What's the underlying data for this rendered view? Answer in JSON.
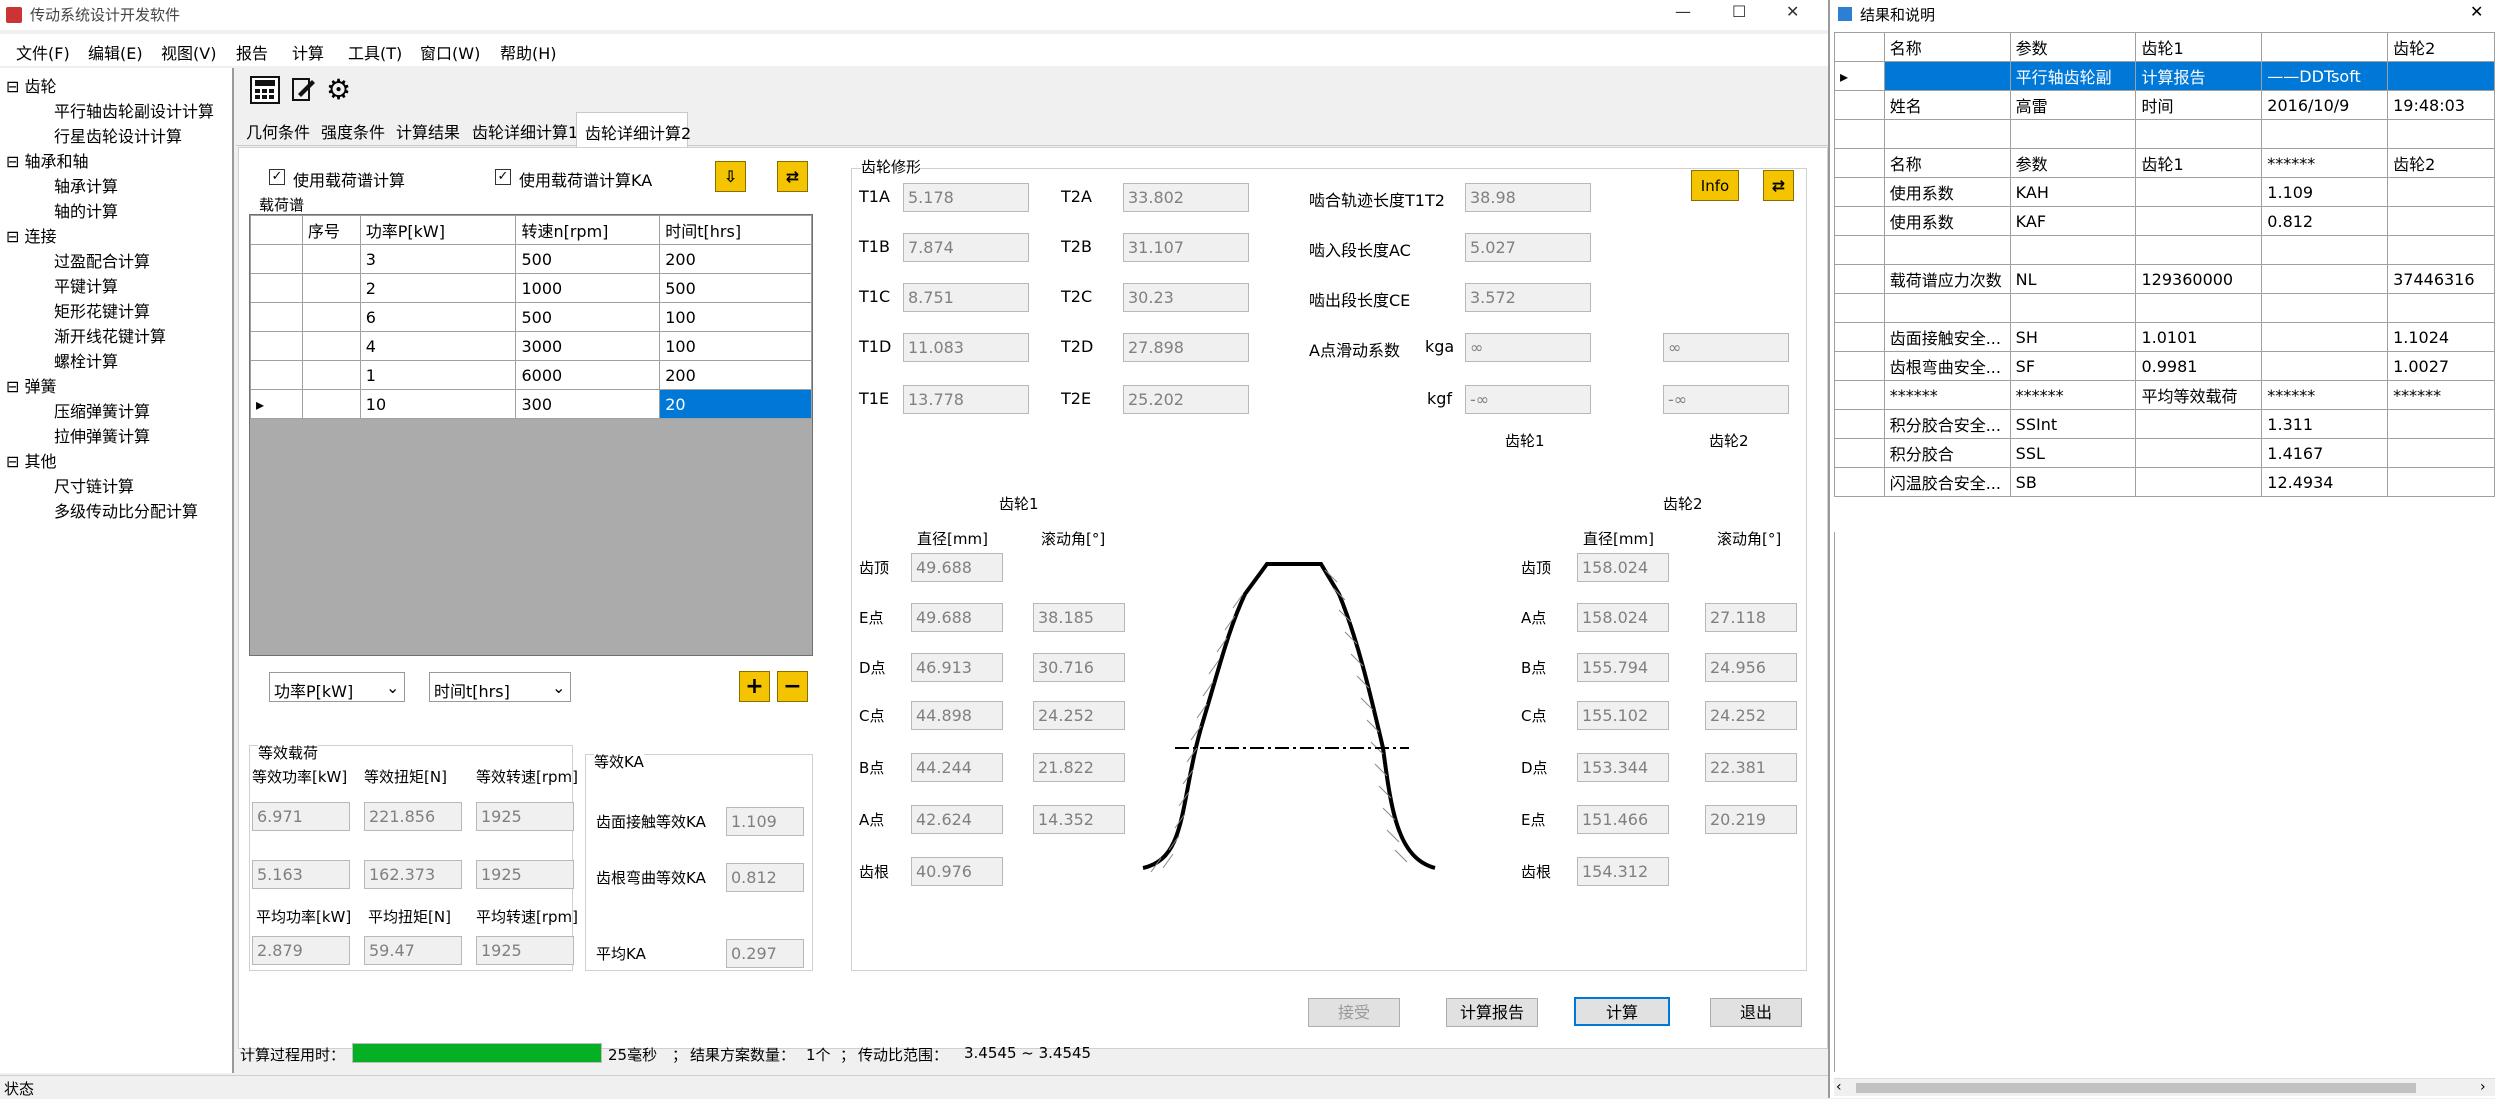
{
  "window": {
    "title": "传动系统设计开发软件",
    "min": "—",
    "max": "☐",
    "close": "✕"
  },
  "menu": [
    "文件(F)",
    "编辑(E)",
    "视图(V)",
    "报告",
    "计算",
    "工具(T)",
    "窗口(W)",
    "帮助(H)"
  ],
  "tree": {
    "groups": [
      {
        "label": "齿轮",
        "items": [
          "平行轴齿轮副设计计算",
          "行星齿轮设计计算"
        ]
      },
      {
        "label": "轴承和轴",
        "items": [
          "轴承计算",
          "轴的计算"
        ]
      },
      {
        "label": "连接",
        "items": [
          "过盈配合计算",
          "平键计算",
          "矩形花键计算",
          "渐开线花键计算",
          "螺栓计算"
        ]
      },
      {
        "label": "弹簧",
        "items": [
          "压缩弹簧计算",
          "拉伸弹簧计算"
        ]
      },
      {
        "label": "其他",
        "items": [
          "尺寸链计算",
          "多级传动比分配计算"
        ]
      }
    ]
  },
  "toolbar": {
    "icons": [
      "calculator-icon",
      "edit-icon",
      "gear-icon"
    ]
  },
  "tabs": [
    "几何条件",
    "强度条件",
    "计算结果",
    "齿轮详细计算1",
    "齿轮详细计算2"
  ],
  "active_tab": 4,
  "load": {
    "use_spectrum": "使用载荷谱计算",
    "use_ka": "使用载荷谱计算KA",
    "section": "载荷谱",
    "headers": [
      "序号",
      "功率P[kW]",
      "转速n[rpm]",
      "时间t[hrs]"
    ],
    "rows": [
      [
        "3",
        "500",
        "200"
      ],
      [
        "2",
        "1000",
        "500"
      ],
      [
        "6",
        "500",
        "100"
      ],
      [
        "4",
        "3000",
        "100"
      ],
      [
        "1",
        "6000",
        "200"
      ],
      [
        "10",
        "300",
        "20"
      ]
    ],
    "combo1": "功率P[kW]",
    "combo2": "时间t[hrs]"
  },
  "equiv": {
    "title": "等效载荷",
    "h1": [
      "等效功率[kW]",
      "等效扭矩[N]",
      "等效转速[rpm]"
    ],
    "r1": [
      "6.971",
      "221.856",
      "1925"
    ],
    "r2": [
      "5.163",
      "162.373",
      "1925"
    ],
    "h2": [
      "平均功率[kW]",
      "平均扭矩[N]",
      "平均转速[rpm]"
    ],
    "r3": [
      "2.879",
      "59.47",
      "1925"
    ]
  },
  "ka": {
    "title": "等效KA",
    "contact": "齿面接触等效KA",
    "contact_v": "1.109",
    "bending": "齿根弯曲等效KA",
    "bending_v": "0.812",
    "avg": "平均KA",
    "avg_v": "0.297"
  },
  "mod": {
    "title": "齿轮修形",
    "t1": [
      [
        "T1A",
        "5.178"
      ],
      [
        "T1B",
        "7.874"
      ],
      [
        "T1C",
        "8.751"
      ],
      [
        "T1D",
        "11.083"
      ],
      [
        "T1E",
        "13.778"
      ]
    ],
    "t2": [
      [
        "T2A",
        "33.802"
      ],
      [
        "T2B",
        "31.107"
      ],
      [
        "T2C",
        "30.23"
      ],
      [
        "T2D",
        "27.898"
      ],
      [
        "T2E",
        "25.202"
      ]
    ],
    "line": "啮合轨迹长度T1T2",
    "line_v": "38.98",
    "ac": "啮入段长度AC",
    "ac_v": "5.027",
    "ce": "啮出段长度CE",
    "ce_v": "3.572",
    "slide": "A点滑动系数",
    "kga": "kga",
    "kga1": "∞",
    "kga2": "∞",
    "kgf": "kgf",
    "kgf1": "-∞",
    "kgf2": "-∞",
    "g1": "齿轮1",
    "g2": "齿轮2",
    "info": "Info"
  },
  "gear1": {
    "title": "齿轮1",
    "h1": "直径[mm]",
    "h2": "滚动角[°]",
    "rows": [
      [
        "齿顶",
        "49.688",
        ""
      ],
      [
        "E点",
        "49.688",
        "38.185"
      ],
      [
        "D点",
        "46.913",
        "30.716"
      ],
      [
        "C点",
        "44.898",
        "24.252"
      ],
      [
        "B点",
        "44.244",
        "21.822"
      ],
      [
        "A点",
        "42.624",
        "14.352"
      ],
      [
        "齿根",
        "40.976",
        ""
      ]
    ]
  },
  "gear2": {
    "title": "齿轮2",
    "h1": "直径[mm]",
    "h2": "滚动角[°]",
    "rows": [
      [
        "齿顶",
        "158.024",
        ""
      ],
      [
        "A点",
        "158.024",
        "27.118"
      ],
      [
        "B点",
        "155.794",
        "24.956"
      ],
      [
        "C点",
        "155.102",
        "24.252"
      ],
      [
        "D点",
        "153.344",
        "22.381"
      ],
      [
        "E点",
        "151.466",
        "20.219"
      ],
      [
        "齿根",
        "154.312",
        ""
      ]
    ]
  },
  "buttons": {
    "accept": "接受",
    "report": "计算报告",
    "calc": "计算",
    "exit": "退出"
  },
  "status": {
    "time_label": "计算过程用时：",
    "time_val": "25毫秒",
    "sep": "；",
    "count_label": "结果方案数量：",
    "count_val": "1个",
    "ratio_label": "传动比范围：",
    "ratio_val": "3.4545 ~ 3.4545",
    "progress": 1.0,
    "state": "状态"
  },
  "result": {
    "title": "结果和说明",
    "close": "✕",
    "headers": [
      "名称",
      "参数",
      "齿轮1",
      "",
      "齿轮2"
    ],
    "rows": [
      [
        "",
        "平行轴齿轮副",
        "计算报告",
        "——DDTsoft",
        ""
      ],
      [
        "姓名",
        "高雷",
        "时间",
        "2016/10/9",
        "19:48:03"
      ],
      [
        "",
        "",
        "",
        "",
        ""
      ],
      [
        "名称",
        "参数",
        "齿轮1",
        "******",
        "齿轮2"
      ],
      [
        "使用系数",
        "KAH",
        "",
        "1.109",
        ""
      ],
      [
        "使用系数",
        "KAF",
        "",
        "0.812",
        ""
      ],
      [
        "",
        "",
        "",
        "",
        ""
      ],
      [
        "载荷谱应力次数",
        "NL",
        "129360000",
        "",
        "37446316"
      ],
      [
        "",
        "",
        "",
        "",
        ""
      ],
      [
        "齿面接触安全...",
        "SH",
        "1.0101",
        "",
        "1.1024"
      ],
      [
        "齿根弯曲安全...",
        "SF",
        "0.9981",
        "",
        "1.0027"
      ],
      [
        "******",
        "******",
        "平均等效载荷",
        "******",
        "******"
      ],
      [
        "积分胶合安全...",
        "SSInt",
        "",
        "1.311",
        ""
      ],
      [
        "积分胶合",
        "SSL",
        "",
        "1.4167",
        ""
      ],
      [
        "闪温胶合安全...",
        "SB",
        "",
        "12.4934",
        ""
      ]
    ]
  }
}
